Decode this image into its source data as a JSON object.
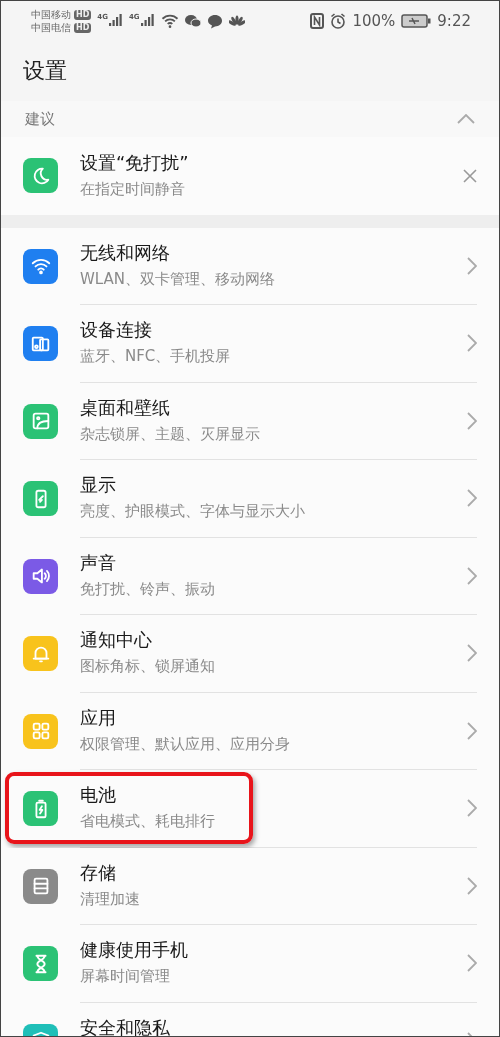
{
  "status_bar": {
    "carriers": [
      {
        "name": "中国移动",
        "badge": "HD"
      },
      {
        "name": "中国电信",
        "badge": "HD"
      }
    ],
    "network": [
      "4G",
      "4G"
    ],
    "battery_percent": "100%",
    "time": "9:22"
  },
  "header": {
    "title": "设置"
  },
  "suggestions": {
    "label": "建议",
    "expanded": true,
    "items": [
      {
        "title": "设置“免打扰”",
        "subtitle": "在指定时间静音",
        "color": "#2bc275"
      }
    ]
  },
  "settings": [
    {
      "title": "无线和网络",
      "subtitle": "WLAN、双卡管理、移动网络",
      "color": "#1f7ff0",
      "highlighted": false
    },
    {
      "title": "设备连接",
      "subtitle": "蓝牙、NFC、手机投屏",
      "color": "#1f7ff0",
      "highlighted": false
    },
    {
      "title": "桌面和壁纸",
      "subtitle": "杂志锁屏、主题、灭屏显示",
      "color": "#2bc275",
      "highlighted": false
    },
    {
      "title": "显示",
      "subtitle": "亮度、护眼模式、字体与显示大小",
      "color": "#2bc275",
      "highlighted": false
    },
    {
      "title": "声音",
      "subtitle": "免打扰、铃声、振动",
      "color": "#7b5ae6",
      "highlighted": false
    },
    {
      "title": "通知中心",
      "subtitle": "图标角标、锁屏通知",
      "color": "#f8c31c",
      "highlighted": false
    },
    {
      "title": "应用",
      "subtitle": "权限管理、默认应用、应用分身",
      "color": "#f8c31c",
      "highlighted": false
    },
    {
      "title": "电池",
      "subtitle": "省电模式、耗电排行",
      "color": "#2bc275",
      "highlighted": true
    },
    {
      "title": "存储",
      "subtitle": "清理加速",
      "color": "#8a8a8a",
      "highlighted": false
    },
    {
      "title": "健康使用手机",
      "subtitle": "屏幕时间管理",
      "color": "#2bc275",
      "highlighted": false
    },
    {
      "title": "安全和隐私",
      "color": "#1fbfb8",
      "highlighted": false
    }
  ]
}
